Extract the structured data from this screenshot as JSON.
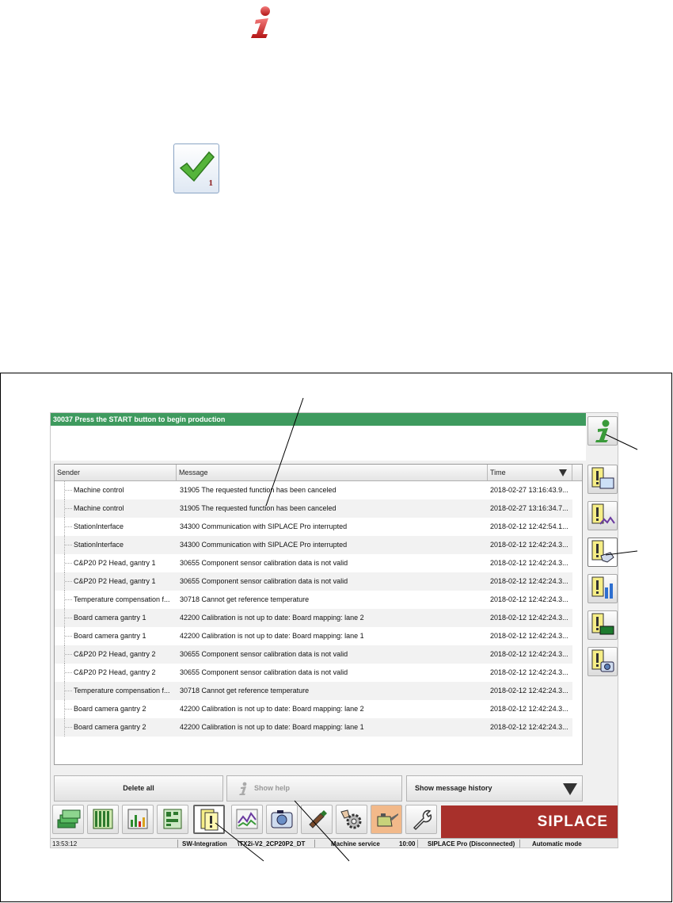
{
  "banner": {
    "text": "30037 Press the START button to begin production",
    "color": "#3e9a5e"
  },
  "check_badge": "1",
  "table": {
    "headers": [
      "Sender",
      "Message",
      "Time"
    ],
    "rows": [
      [
        "Machine control",
        "31905 The requested function has been canceled",
        "2018-02-27 13:16:43.9..."
      ],
      [
        "Machine control",
        "31905 The requested function has been canceled",
        "2018-02-27 13:16:34.7..."
      ],
      [
        "StationInterface",
        "34300 Communication with SIPLACE Pro interrupted",
        "2018-02-12 12:42:54.1..."
      ],
      [
        "StationInterface",
        "34300 Communication with SIPLACE Pro interrupted",
        "2018-02-12 12:42:24.3..."
      ],
      [
        "C&P20 P2 Head, gantry 1",
        "30655 Component sensor calibration data is not valid",
        "2018-02-12 12:42:24.3..."
      ],
      [
        "C&P20 P2 Head, gantry 1",
        "30655 Component sensor calibration data is not valid",
        "2018-02-12 12:42:24.3..."
      ],
      [
        "Temperature compensation f...",
        "30718 Cannot get reference temperature",
        "2018-02-12 12:42:24.3..."
      ],
      [
        "Board camera gantry 1",
        "42200 Calibration is not up to date: Board mapping: lane 2",
        "2018-02-12 12:42:24.3..."
      ],
      [
        "Board camera gantry 1",
        "42200 Calibration is not up to date: Board mapping: lane 1",
        "2018-02-12 12:42:24.3..."
      ],
      [
        "C&P20 P2 Head, gantry 2",
        "30655 Component sensor calibration data is not valid",
        "2018-02-12 12:42:24.3..."
      ],
      [
        "C&P20 P2 Head, gantry 2",
        "30655 Component sensor calibration data is not valid",
        "2018-02-12 12:42:24.3..."
      ],
      [
        "Temperature compensation f...",
        "30718 Cannot get reference temperature",
        "2018-02-12 12:42:24.3..."
      ],
      [
        "Board camera gantry 2",
        "42200 Calibration is not up to date: Board mapping: lane 2",
        "2018-02-12 12:42:24.3..."
      ],
      [
        "Board camera gantry 2",
        "42200 Calibration is not up to date: Board mapping: lane 1",
        "2018-02-12 12:42:24.3..."
      ]
    ]
  },
  "buttons": {
    "delete_all": "Delete all",
    "show_help": "Show help",
    "show_history": "Show message history"
  },
  "sidebar_icons": [
    "info-icon",
    "messages-monitor-icon",
    "messages-chart-icon",
    "messages-hand-icon",
    "messages-bars-icon",
    "messages-battery-icon",
    "messages-camera-icon"
  ],
  "taskbar_icons": [
    "production-stack-icon",
    "feeder-grid-icon",
    "bar-chart-icon",
    "board-layout-icon",
    "messages-icon",
    "line-chart-icon",
    "camera-icon",
    "component-icon",
    "settings-hand-icon",
    "oil-can-icon",
    "wrench-icon"
  ],
  "brand": {
    "text": "SIPLACE",
    "color": "#a8302b"
  },
  "status": {
    "time": "13:53:12",
    "station": "SW-Integration",
    "path": "\\TX2i-V2_2CP20P2_DT",
    "mode_service": "Machine service",
    "clock": "10:00",
    "pro": "SIPLACE Pro (Disconnected)",
    "auto": "Automatic mode"
  }
}
